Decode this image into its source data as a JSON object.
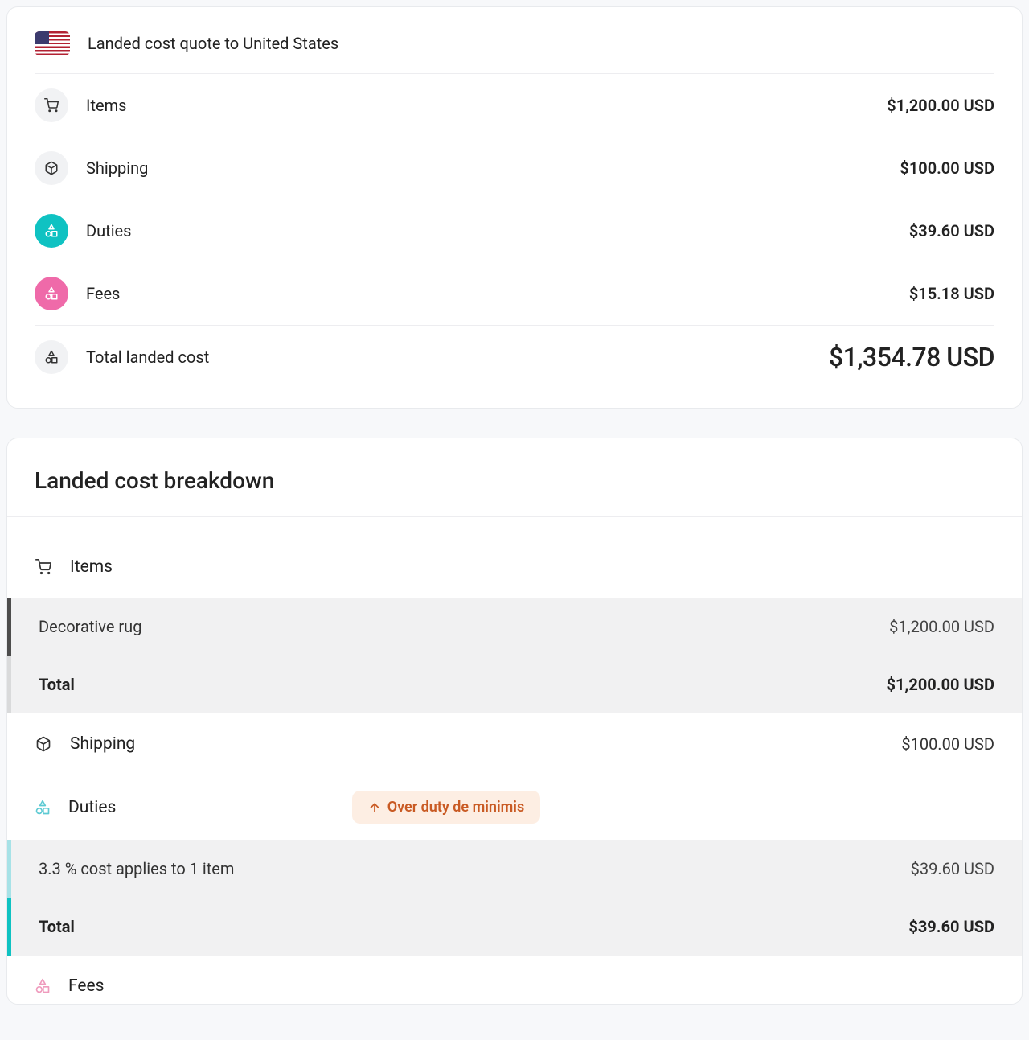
{
  "summary": {
    "title": "Landed cost quote to United States",
    "items": {
      "label": "Items",
      "value": "$1,200.00 USD"
    },
    "shipping": {
      "label": "Shipping",
      "value": "$100.00 USD"
    },
    "duties": {
      "label": "Duties",
      "value": "$39.60 USD"
    },
    "fees": {
      "label": "Fees",
      "value": "$15.18 USD"
    },
    "total": {
      "label": "Total landed cost",
      "value": "$1,354.78 USD"
    }
  },
  "breakdown": {
    "title": "Landed cost breakdown",
    "items_section": {
      "label": "Items",
      "rows": [
        {
          "label": "Decorative rug",
          "value": "$1,200.00 USD"
        }
      ],
      "total": {
        "label": "Total",
        "value": "$1,200.00 USD"
      }
    },
    "shipping_section": {
      "label": "Shipping",
      "value": "$100.00 USD"
    },
    "duties_section": {
      "label": "Duties",
      "badge": "Over duty de minimis",
      "rows": [
        {
          "label": "3.3 % cost applies to 1 item",
          "value": "$39.60 USD"
        }
      ],
      "total": {
        "label": "Total",
        "value": "$39.60 USD"
      }
    },
    "fees_section": {
      "label": "Fees"
    }
  }
}
